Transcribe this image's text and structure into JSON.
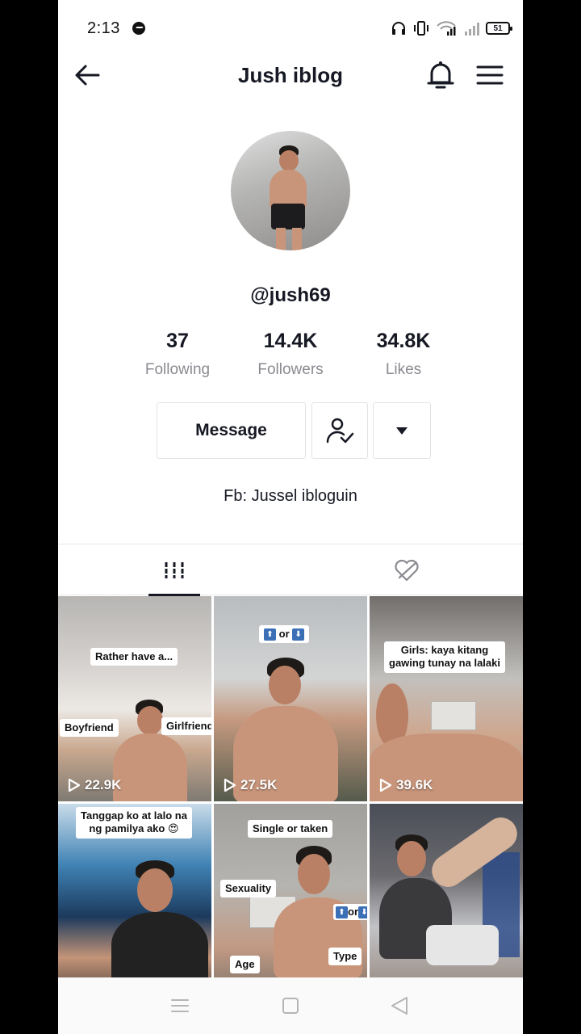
{
  "status_bar": {
    "time": "2:13",
    "battery": "51",
    "icons": [
      "messenger-icon",
      "headphones-icon",
      "vibrate-icon",
      "wifi-icon",
      "signal-icon",
      "signal-icon",
      "battery-icon"
    ]
  },
  "header": {
    "title": "Jush iblog",
    "icons": [
      "back-arrow-icon",
      "bell-icon",
      "hamburger-menu-icon"
    ]
  },
  "profile": {
    "username": "@jush69",
    "bio": "Fb: Jussel ibloguin",
    "stats": [
      {
        "value": "37",
        "label": "Following"
      },
      {
        "value": "14.4K",
        "label": "Followers"
      },
      {
        "value": "34.8K",
        "label": "Likes"
      }
    ],
    "message_label": "Message",
    "icons": [
      "user-check-icon",
      "caret-down-icon"
    ]
  },
  "tabs": [
    {
      "name": "videos",
      "icon": "grid-bars-icon",
      "active": true
    },
    {
      "name": "liked",
      "icon": "hidden-heart-icon",
      "active": false
    }
  ],
  "videos": [
    {
      "views": "22.9K",
      "captions": {
        "top": "Rather have a...",
        "left": "Boyfriend",
        "right": "Girlfriend"
      }
    },
    {
      "views": "27.5K",
      "captions": {
        "top": "or"
      }
    },
    {
      "views": "39.6K",
      "captions": {
        "top": "Girls: kaya kitang\ngawing tunay na lalaki",
        "dots": ". ."
      }
    },
    {
      "views": "",
      "captions": {
        "top": "Tanggap ko at lalo na\nng pamilya ako 😍"
      }
    },
    {
      "views": "",
      "captions": {
        "top": "Single or taken",
        "left": "Sexuality",
        "right": "or",
        "bottom_left": "Age",
        "bottom_right": "Type"
      }
    },
    {
      "views": "",
      "captions": {}
    }
  ],
  "nav_bar": {
    "icons": [
      "recents-menu-icon",
      "home-square-icon",
      "back-triangle-icon"
    ]
  },
  "colors": {
    "text_primary": "#161823",
    "text_secondary": "#8a8b91",
    "border": "#e3e3e4"
  }
}
